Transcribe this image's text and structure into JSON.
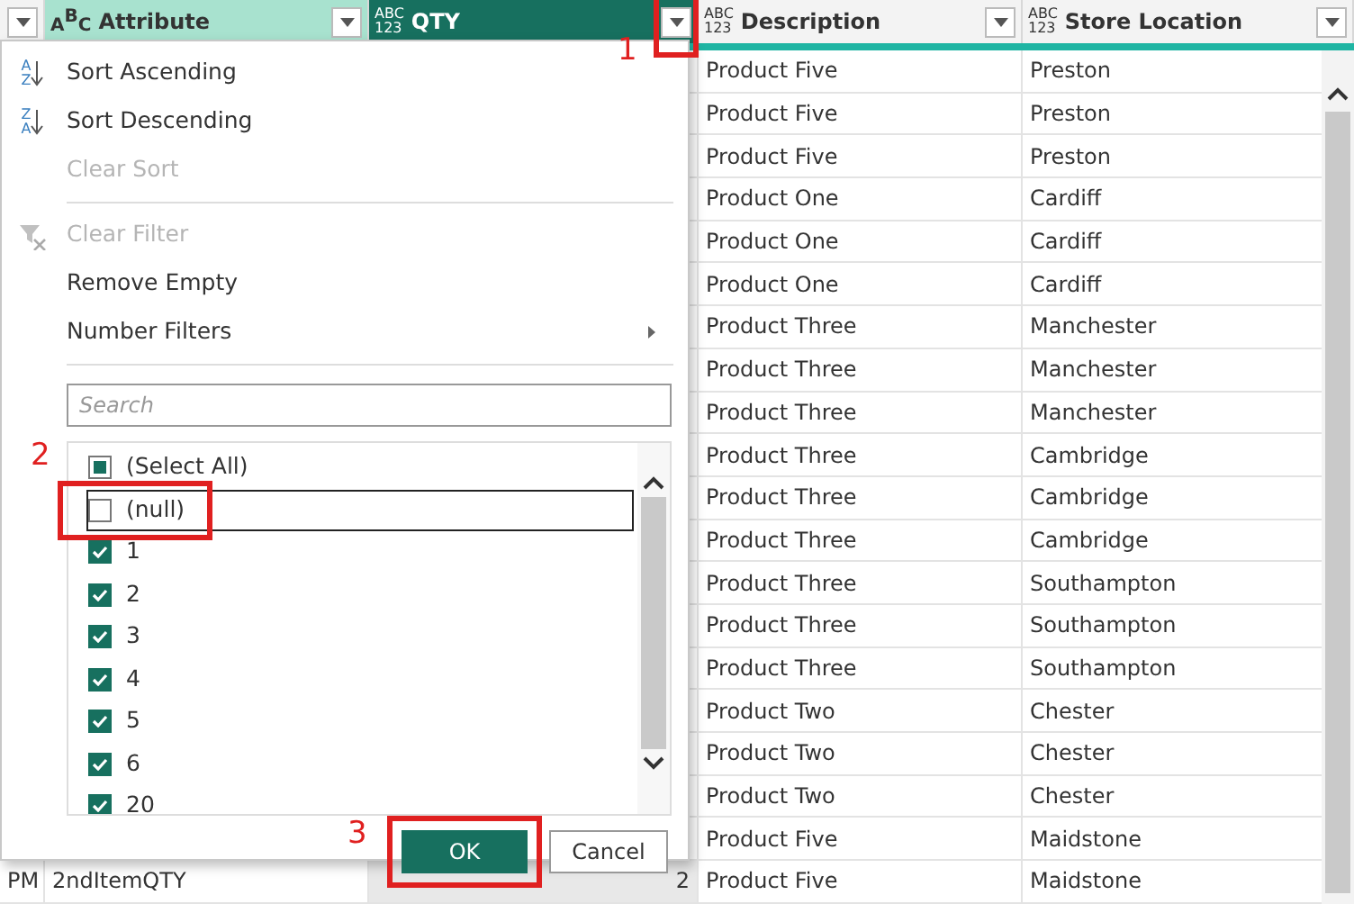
{
  "columns": [
    {
      "kind": "blank",
      "selected": false
    },
    {
      "kind": "text",
      "type_badge": [
        "A",
        "B",
        "C"
      ],
      "label": "Attribute",
      "selected": false
    },
    {
      "kind": "any",
      "type_badge": [
        "ABC",
        "123"
      ],
      "label": "QTY",
      "selected": true
    },
    {
      "kind": "any",
      "type_badge": [
        "ABC",
        "123"
      ],
      "label": "Description",
      "selected": false
    },
    {
      "kind": "any",
      "type_badge": [
        "ABC",
        "123"
      ],
      "label": "Store Location",
      "selected": false
    }
  ],
  "rows": [
    {
      "description": "Product Five",
      "store_location": "Preston"
    },
    {
      "description": "Product Five",
      "store_location": "Preston"
    },
    {
      "description": "Product Five",
      "store_location": "Preston"
    },
    {
      "description": "Product One",
      "store_location": "Cardiff"
    },
    {
      "description": "Product One",
      "store_location": "Cardiff"
    },
    {
      "description": "Product One",
      "store_location": "Cardiff"
    },
    {
      "description": "Product Three",
      "store_location": "Manchester"
    },
    {
      "description": "Product Three",
      "store_location": "Manchester"
    },
    {
      "description": "Product Three",
      "store_location": "Manchester"
    },
    {
      "description": "Product Three",
      "store_location": "Cambridge"
    },
    {
      "description": "Product Three",
      "store_location": "Cambridge"
    },
    {
      "description": "Product Three",
      "store_location": "Cambridge"
    },
    {
      "description": "Product Three",
      "store_location": "Southampton"
    },
    {
      "description": "Product Three",
      "store_location": "Southampton"
    },
    {
      "description": "Product Three",
      "store_location": "Southampton"
    },
    {
      "description": "Product Two",
      "store_location": "Chester"
    },
    {
      "description": "Product Two",
      "store_location": "Chester"
    },
    {
      "description": "Product Two",
      "store_location": "Chester"
    },
    {
      "description": "Product Five",
      "store_location": "Maidstone"
    },
    {
      "column_1": "PM",
      "attribute": "2ndItemQTY",
      "qty": "2",
      "description": "Product Five",
      "store_location": "Maidstone"
    }
  ],
  "filter_menu": {
    "items": [
      {
        "kind": "sort",
        "icon_text": [
          "A",
          "Z"
        ],
        "label": "Sort Ascending",
        "disabled": false
      },
      {
        "kind": "sort",
        "icon_text": [
          "Z",
          "A"
        ],
        "label": "Sort Descending",
        "disabled": false
      },
      {
        "kind": "item",
        "label": "Clear Sort",
        "disabled": true
      },
      {
        "kind": "separator"
      },
      {
        "kind": "filter",
        "label": "Clear Filter",
        "disabled": true
      },
      {
        "kind": "item",
        "label": "Remove Empty",
        "disabled": false
      },
      {
        "kind": "item",
        "label": "Number Filters",
        "disabled": false,
        "submenu": true
      },
      {
        "kind": "separator"
      }
    ],
    "search": {
      "placeholder": "Search"
    },
    "values": [
      {
        "kind": "select-all",
        "label": "(Select All)",
        "checked": true,
        "indeterminate": true,
        "focused": false
      },
      {
        "kind": "value",
        "label": "(null)",
        "checked": false,
        "focused": true
      },
      {
        "kind": "value",
        "label": "1",
        "checked": true,
        "focused": false
      },
      {
        "kind": "value",
        "label": "2",
        "checked": true,
        "focused": false
      },
      {
        "kind": "value",
        "label": "3",
        "checked": true,
        "focused": false
      },
      {
        "kind": "value",
        "label": "4",
        "checked": true,
        "focused": false
      },
      {
        "kind": "value",
        "label": "5",
        "checked": true,
        "focused": false
      },
      {
        "kind": "value",
        "label": "6",
        "checked": true,
        "focused": false
      },
      {
        "kind": "value",
        "label": "20",
        "checked": true,
        "focused": false
      }
    ],
    "buttons": [
      {
        "kind": "primary",
        "label": "OK"
      },
      {
        "kind": "secondary",
        "label": "Cancel"
      }
    ]
  },
  "annotations": [
    {
      "label": "1"
    },
    {
      "label": "2"
    },
    {
      "label": "3"
    }
  ]
}
